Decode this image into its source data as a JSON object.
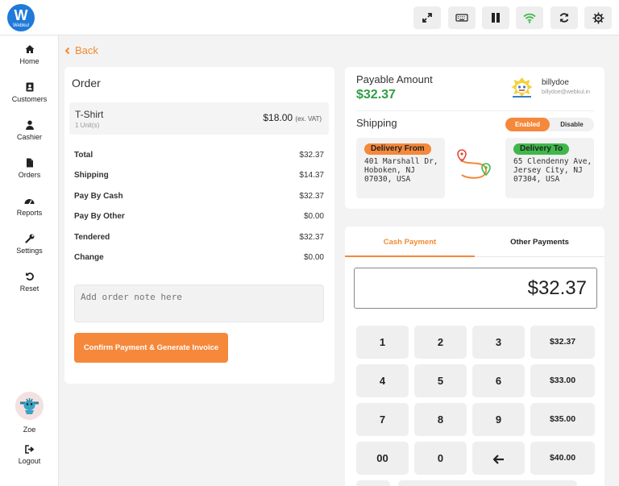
{
  "brand": {
    "logo_letter": "W",
    "logo_text": "Webkul"
  },
  "toolbar": {
    "buttons": [
      "fullscreen-icon",
      "keyboard-icon",
      "pause-icon",
      "wifi-icon",
      "refresh-icon",
      "settings-icon"
    ],
    "wifi_color": "#3fb84a"
  },
  "sidebar": {
    "items": [
      {
        "label": "Home",
        "icon": "home-icon"
      },
      {
        "label": "Customers",
        "icon": "customers-icon"
      },
      {
        "label": "Cashier",
        "icon": "cashier-icon"
      },
      {
        "label": "Orders",
        "icon": "orders-icon"
      },
      {
        "label": "Reports",
        "icon": "reports-icon"
      },
      {
        "label": "Settings",
        "icon": "wrench-icon"
      },
      {
        "label": "Reset",
        "icon": "reset-icon"
      }
    ],
    "user_name": "Zoe",
    "logout_label": "Logout"
  },
  "back_label": "Back",
  "order": {
    "title": "Order",
    "item": {
      "name": "T-Shirt",
      "units": "1 Unit(s)",
      "price": "$18.00",
      "vat_note": "(ex. VAT)"
    },
    "summary": [
      {
        "label": "Total",
        "value": "$32.37"
      },
      {
        "label": "Shipping",
        "value": "$14.37"
      },
      {
        "label": "Pay By Cash",
        "value": "$32.37"
      },
      {
        "label": "Pay By Other",
        "value": "$0.00"
      },
      {
        "label": "Tendered",
        "value": "$32.37"
      },
      {
        "label": "Change",
        "value": "$0.00"
      }
    ],
    "note_placeholder": "Add order note here",
    "confirm_label": "Confirm Payment & Generate Invoice"
  },
  "payable": {
    "title": "Payable Amount",
    "amount": "$32.37",
    "customer_name": "billydoe",
    "customer_email": "billydoe@webkul.in"
  },
  "shipping": {
    "title": "Shipping",
    "toggle_on": "Enabled",
    "toggle_off": "Disable",
    "from_label": "Delivery From",
    "from_address": "401 Marshall Dr, Hoboken, NJ 07030, USA",
    "to_label": "Delivery To",
    "to_address": "65 Clendenny Ave, Jersey City, NJ 07304, USA"
  },
  "payment": {
    "tabs": [
      "Cash Payment",
      "Other Payments"
    ],
    "amount_display": "$32.37",
    "keypad": [
      [
        "1",
        "2",
        "3",
        "$32.37"
      ],
      [
        "4",
        "5",
        "6",
        "$33.00"
      ],
      [
        "7",
        "8",
        "9",
        "$35.00"
      ],
      [
        "00",
        "0",
        "backspace-icon",
        "$40.00"
      ]
    ]
  },
  "colors": {
    "accent": "#f5883b",
    "success": "#2f9e44",
    "brand": "#1f7ad9"
  }
}
